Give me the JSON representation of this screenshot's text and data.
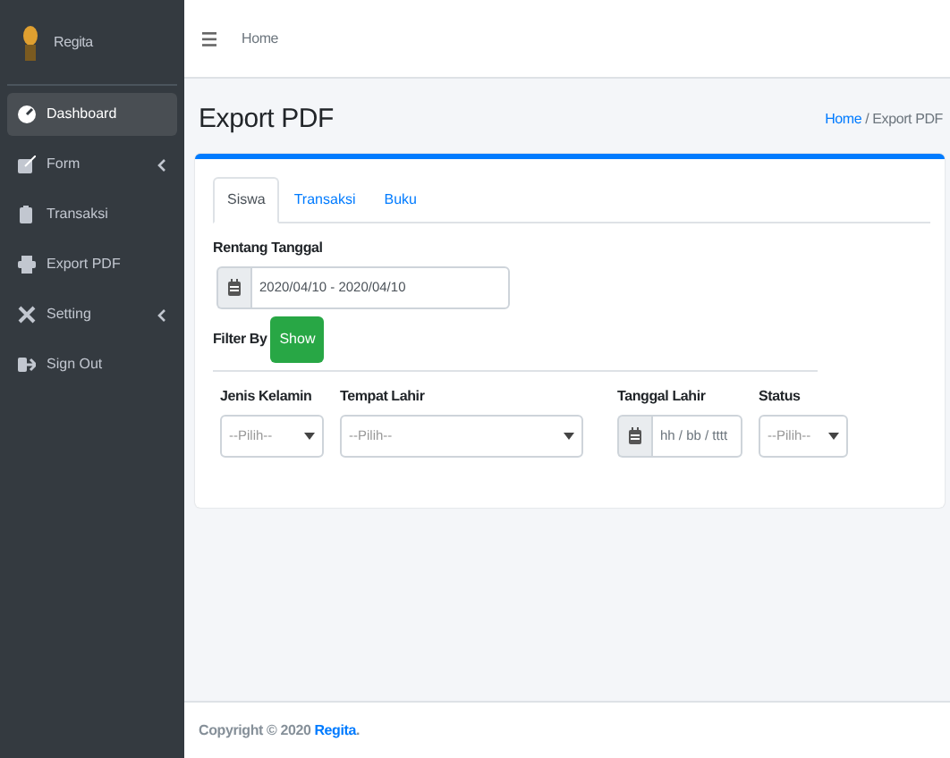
{
  "sidebar": {
    "brand": "Regita",
    "items": [
      {
        "label": "Dashboard",
        "selected": true,
        "expandable": false
      },
      {
        "label": "Form",
        "selected": false,
        "expandable": true
      },
      {
        "label": "Transaksi",
        "selected": false,
        "expandable": false
      },
      {
        "label": "Export PDF",
        "selected": false,
        "expandable": false
      },
      {
        "label": "Setting",
        "selected": false,
        "expandable": true
      },
      {
        "label": "Sign Out",
        "selected": false,
        "expandable": false
      }
    ]
  },
  "topbar": {
    "link": "Home"
  },
  "page": {
    "title": "Export PDF",
    "breadcrumb": [
      {
        "label": "Home",
        "link": true
      },
      {
        "label": "Export PDF",
        "link": false
      }
    ],
    "breadcrumb_separator": "/"
  },
  "tabs": [
    {
      "label": "Siswa",
      "selected": true
    },
    {
      "label": "Transaksi",
      "selected": false
    },
    {
      "label": "Buku",
      "selected": false
    }
  ],
  "range": {
    "label": "Rentang Tanggal",
    "value": "2020/04/10 - 2020/04/10"
  },
  "filter": {
    "label": "Filter By",
    "button": "Show"
  },
  "filters": [
    {
      "kind": "select",
      "label": "Jenis Kelamin",
      "value": "--Pilih--"
    },
    {
      "kind": "select",
      "label": "Tempat Lahir",
      "value": "--Pilih--"
    },
    {
      "kind": "date",
      "label": "Tanggal Lahir",
      "placeholder": "hh / bb / tttt"
    },
    {
      "kind": "select",
      "label": "Status",
      "value": "--Pilih--"
    }
  ],
  "footer": {
    "text": "Copyright © 2020 ",
    "link": "Regita",
    "suffix": "."
  }
}
